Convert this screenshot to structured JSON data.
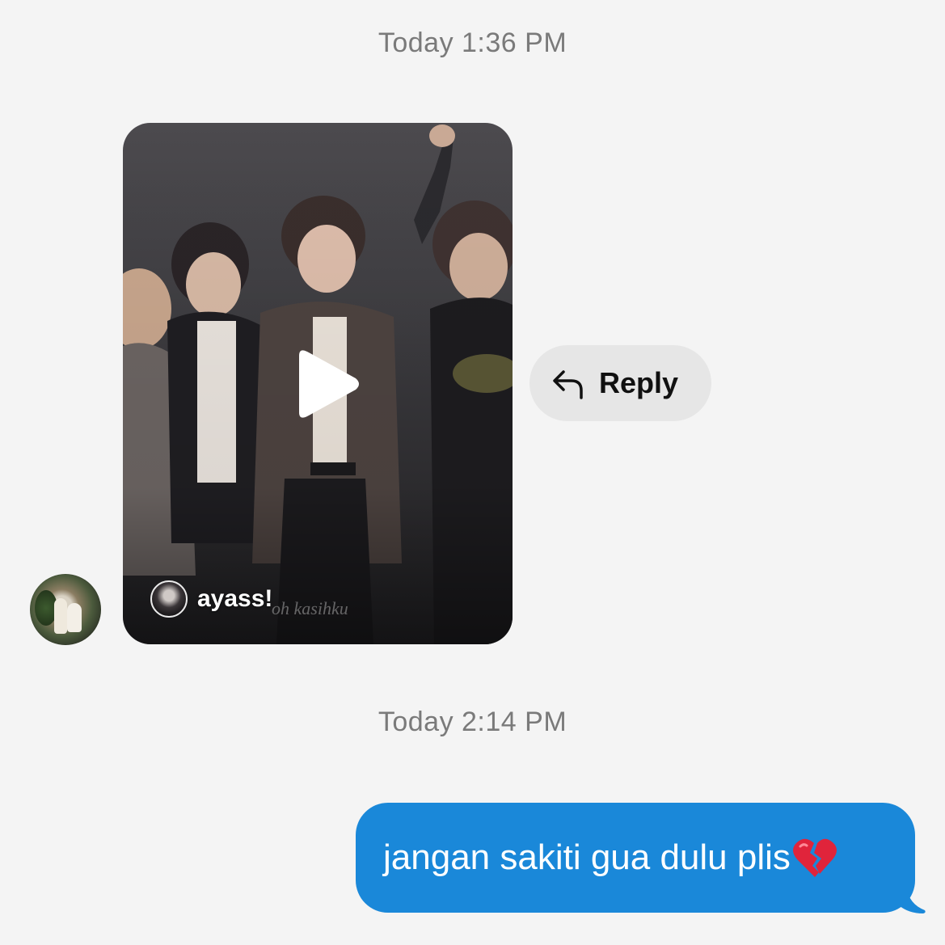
{
  "timestamps": {
    "first": "Today 1:36 PM",
    "second": "Today 2:14 PM"
  },
  "shared_video": {
    "author": "ayass!",
    "watermark": "oh kasihku",
    "play_icon": "play-icon"
  },
  "reply_button": {
    "label": "Reply",
    "icon": "reply-arrow-icon"
  },
  "sent_message": {
    "text": "jangan sakiti gua dulu plis",
    "emoji": "broken-heart-icon",
    "bubble_color": "#1a88d9"
  },
  "colors": {
    "background": "#f4f4f4",
    "timestamp": "#7a7a7a",
    "reply_pill": "#e6e6e6"
  }
}
